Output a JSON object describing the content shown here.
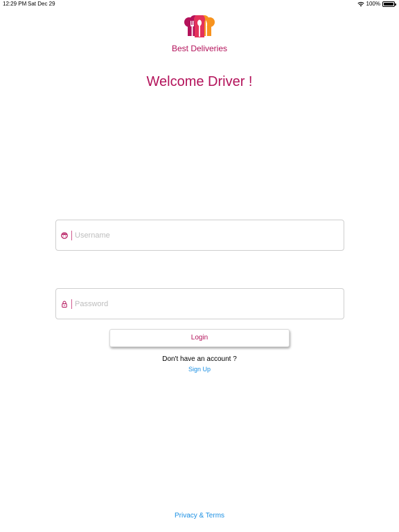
{
  "status_bar": {
    "time": "12:29 PM",
    "date": "Sat Dec 29",
    "battery": "100%"
  },
  "brand": {
    "name": "Best Deliveries",
    "colors": {
      "primary": "#b3125a",
      "accent": "#f7931e",
      "link": "#1a8fe3"
    }
  },
  "welcome": "Welcome Driver !",
  "form": {
    "username": {
      "value": "",
      "placeholder": "Username",
      "icon": "user-face-icon"
    },
    "password": {
      "value": "",
      "placeholder": "Password",
      "icon": "lock-icon"
    },
    "login_label": "Login"
  },
  "signup": {
    "prompt": "Don't have an account ?",
    "link": "Sign Up"
  },
  "footer": {
    "privacy": "Privacy & Terms"
  }
}
